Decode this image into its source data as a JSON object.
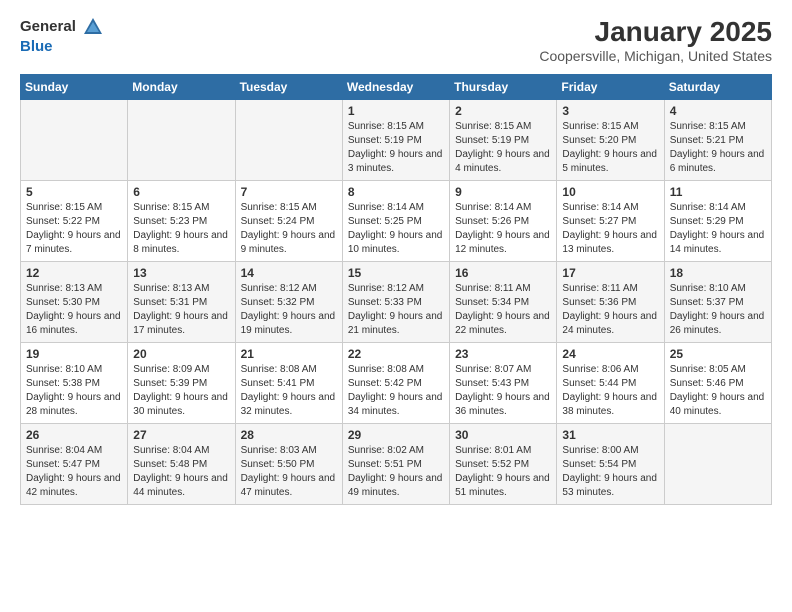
{
  "logo": {
    "general": "General",
    "blue": "Blue"
  },
  "title": "January 2025",
  "location": "Coopersville, Michigan, United States",
  "days_of_week": [
    "Sunday",
    "Monday",
    "Tuesday",
    "Wednesday",
    "Thursday",
    "Friday",
    "Saturday"
  ],
  "weeks": [
    [
      {
        "day": "",
        "info": ""
      },
      {
        "day": "",
        "info": ""
      },
      {
        "day": "",
        "info": ""
      },
      {
        "day": "1",
        "info": "Sunrise: 8:15 AM\nSunset: 5:19 PM\nDaylight: 9 hours and 3 minutes."
      },
      {
        "day": "2",
        "info": "Sunrise: 8:15 AM\nSunset: 5:19 PM\nDaylight: 9 hours and 4 minutes."
      },
      {
        "day": "3",
        "info": "Sunrise: 8:15 AM\nSunset: 5:20 PM\nDaylight: 9 hours and 5 minutes."
      },
      {
        "day": "4",
        "info": "Sunrise: 8:15 AM\nSunset: 5:21 PM\nDaylight: 9 hours and 6 minutes."
      }
    ],
    [
      {
        "day": "5",
        "info": "Sunrise: 8:15 AM\nSunset: 5:22 PM\nDaylight: 9 hours and 7 minutes."
      },
      {
        "day": "6",
        "info": "Sunrise: 8:15 AM\nSunset: 5:23 PM\nDaylight: 9 hours and 8 minutes."
      },
      {
        "day": "7",
        "info": "Sunrise: 8:15 AM\nSunset: 5:24 PM\nDaylight: 9 hours and 9 minutes."
      },
      {
        "day": "8",
        "info": "Sunrise: 8:14 AM\nSunset: 5:25 PM\nDaylight: 9 hours and 10 minutes."
      },
      {
        "day": "9",
        "info": "Sunrise: 8:14 AM\nSunset: 5:26 PM\nDaylight: 9 hours and 12 minutes."
      },
      {
        "day": "10",
        "info": "Sunrise: 8:14 AM\nSunset: 5:27 PM\nDaylight: 9 hours and 13 minutes."
      },
      {
        "day": "11",
        "info": "Sunrise: 8:14 AM\nSunset: 5:29 PM\nDaylight: 9 hours and 14 minutes."
      }
    ],
    [
      {
        "day": "12",
        "info": "Sunrise: 8:13 AM\nSunset: 5:30 PM\nDaylight: 9 hours and 16 minutes."
      },
      {
        "day": "13",
        "info": "Sunrise: 8:13 AM\nSunset: 5:31 PM\nDaylight: 9 hours and 17 minutes."
      },
      {
        "day": "14",
        "info": "Sunrise: 8:12 AM\nSunset: 5:32 PM\nDaylight: 9 hours and 19 minutes."
      },
      {
        "day": "15",
        "info": "Sunrise: 8:12 AM\nSunset: 5:33 PM\nDaylight: 9 hours and 21 minutes."
      },
      {
        "day": "16",
        "info": "Sunrise: 8:11 AM\nSunset: 5:34 PM\nDaylight: 9 hours and 22 minutes."
      },
      {
        "day": "17",
        "info": "Sunrise: 8:11 AM\nSunset: 5:36 PM\nDaylight: 9 hours and 24 minutes."
      },
      {
        "day": "18",
        "info": "Sunrise: 8:10 AM\nSunset: 5:37 PM\nDaylight: 9 hours and 26 minutes."
      }
    ],
    [
      {
        "day": "19",
        "info": "Sunrise: 8:10 AM\nSunset: 5:38 PM\nDaylight: 9 hours and 28 minutes."
      },
      {
        "day": "20",
        "info": "Sunrise: 8:09 AM\nSunset: 5:39 PM\nDaylight: 9 hours and 30 minutes."
      },
      {
        "day": "21",
        "info": "Sunrise: 8:08 AM\nSunset: 5:41 PM\nDaylight: 9 hours and 32 minutes."
      },
      {
        "day": "22",
        "info": "Sunrise: 8:08 AM\nSunset: 5:42 PM\nDaylight: 9 hours and 34 minutes."
      },
      {
        "day": "23",
        "info": "Sunrise: 8:07 AM\nSunset: 5:43 PM\nDaylight: 9 hours and 36 minutes."
      },
      {
        "day": "24",
        "info": "Sunrise: 8:06 AM\nSunset: 5:44 PM\nDaylight: 9 hours and 38 minutes."
      },
      {
        "day": "25",
        "info": "Sunrise: 8:05 AM\nSunset: 5:46 PM\nDaylight: 9 hours and 40 minutes."
      }
    ],
    [
      {
        "day": "26",
        "info": "Sunrise: 8:04 AM\nSunset: 5:47 PM\nDaylight: 9 hours and 42 minutes."
      },
      {
        "day": "27",
        "info": "Sunrise: 8:04 AM\nSunset: 5:48 PM\nDaylight: 9 hours and 44 minutes."
      },
      {
        "day": "28",
        "info": "Sunrise: 8:03 AM\nSunset: 5:50 PM\nDaylight: 9 hours and 47 minutes."
      },
      {
        "day": "29",
        "info": "Sunrise: 8:02 AM\nSunset: 5:51 PM\nDaylight: 9 hours and 49 minutes."
      },
      {
        "day": "30",
        "info": "Sunrise: 8:01 AM\nSunset: 5:52 PM\nDaylight: 9 hours and 51 minutes."
      },
      {
        "day": "31",
        "info": "Sunrise: 8:00 AM\nSunset: 5:54 PM\nDaylight: 9 hours and 53 minutes."
      },
      {
        "day": "",
        "info": ""
      }
    ]
  ]
}
